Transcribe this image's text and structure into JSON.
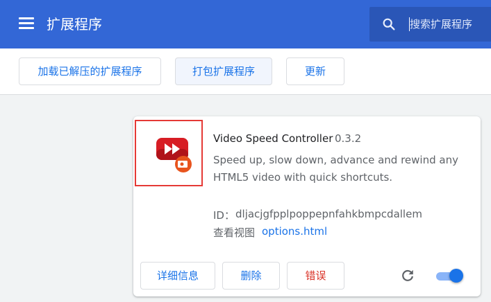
{
  "header": {
    "title": "扩展程序",
    "menu_icon": "menu-icon",
    "search": {
      "placeholder": "搜索扩展程序",
      "value": "",
      "icon": "search-icon"
    }
  },
  "toolbar": {
    "load_unpacked_label": "加载已解压的扩展程序",
    "pack_label": "打包扩展程序",
    "update_label": "更新"
  },
  "extension": {
    "name": "Video Speed Controller",
    "version": "0.3.2",
    "description": "Speed up, slow down, advance and rewind any HTML5 video with quick shortcuts.",
    "id_label": "ID：",
    "id_value": "dljacjgfpplpoppepnfahkbmpcdallem",
    "view_label": "查看视图",
    "view_link": "options.html",
    "details_label": "详细信息",
    "remove_label": "删除",
    "errors_label": "错误",
    "enabled": true,
    "icon": "video-speed-controller-icon",
    "reload_icon": "reload-icon"
  },
  "colors": {
    "header_bg": "#3367d6",
    "search_bg": "#2a56b7",
    "accent": "#1a73e8",
    "error": "#d93025",
    "highlight_frame": "#e53935"
  }
}
